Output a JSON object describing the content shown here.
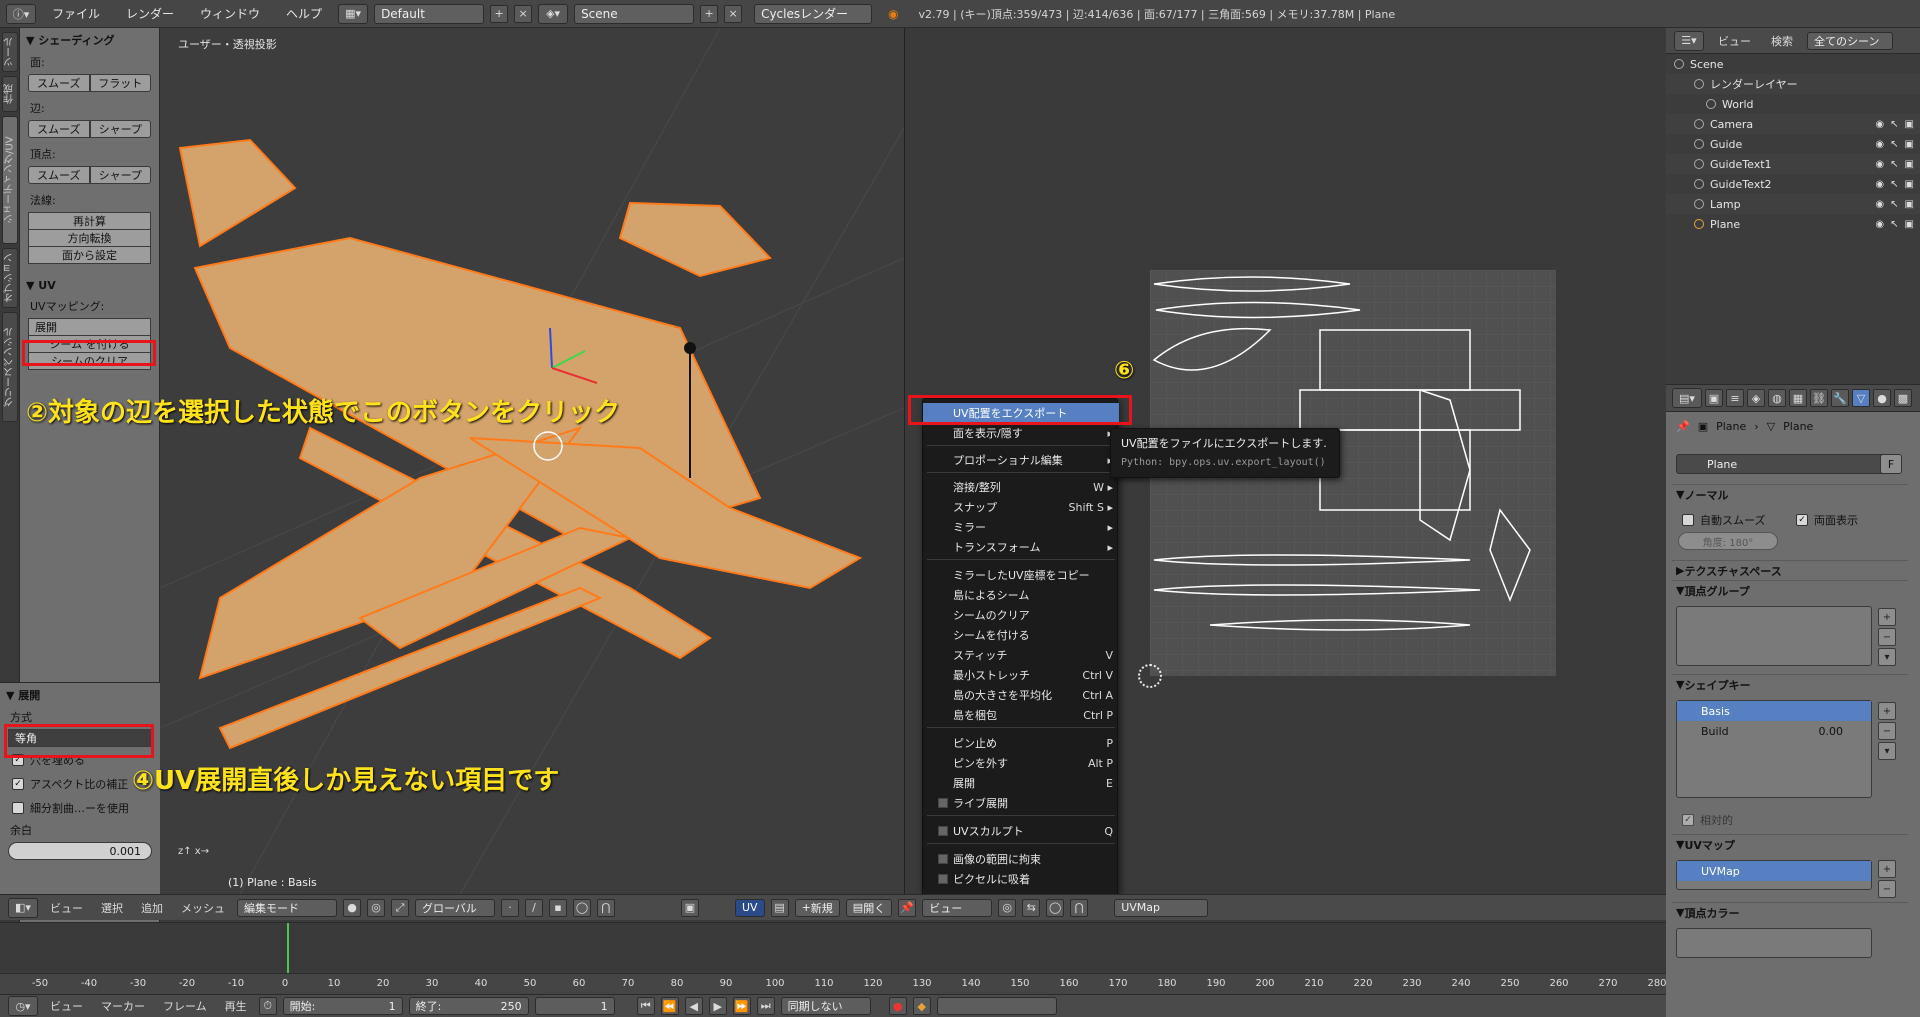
{
  "topbar": {
    "menus": [
      "ファイル",
      "レンダー",
      "ウィンドウ",
      "ヘルプ"
    ],
    "layout": "Default",
    "scene": "Scene",
    "engine": "Cyclesレンダー",
    "stats": "v2.79 | (キー)頂点:359/473 | 辺:414/636 | 面:67/177 | 三角面:569 | メモリ:37.78M | Plane"
  },
  "vtabs": [
    "ツール",
    "作成",
    "シェーディング/UV",
    "オプション",
    "グリースペンシル"
  ],
  "shading": {
    "title": "シェーディング",
    "face_label": "面:",
    "smooth": "スムーズ",
    "flat": "フラット",
    "edge_label": "辺:",
    "sharp": "シャープ",
    "vertex_label": "頂点:",
    "normals_label": "法線:",
    "recalc": "再計算",
    "flip": "方向転換",
    "from_face": "面から設定"
  },
  "uvpanel": {
    "title": "UV",
    "mapping_label": "UVマッピング:",
    "unwrap": "展開",
    "mark_seam": "シーム を付ける",
    "clear_seam": "シームのクリア"
  },
  "redo": {
    "title": "展開",
    "method_label": "方式",
    "method": "等角",
    "fill_holes": "穴を埋める",
    "aspect": "アスペクト比の補正",
    "subsurf": "細分割曲…ーを使用",
    "margin_label": "余白",
    "margin": "0.001"
  },
  "view3d": {
    "title": "ユーザー・透視投影",
    "footer": "(1) Plane : Basis"
  },
  "annotations": {
    "a2": "②対象の辺を選択した状態でこのボタンをクリック",
    "a4": "④UV展開直後しか見えない項目です",
    "a6": "⑥"
  },
  "uvmenu": {
    "items": [
      {
        "label": "UV配置をエクスポート",
        "shortcut": ""
      },
      {
        "label": "面を表示/隠す",
        "shortcut": ""
      },
      {
        "label": "プロポーショナル編集",
        "shortcut": ""
      },
      {
        "label": "溶接/整列",
        "shortcut": "W"
      },
      {
        "label": "スナップ",
        "shortcut": "Shift S"
      },
      {
        "label": "ミラー",
        "shortcut": ""
      },
      {
        "label": "トランスフォーム",
        "shortcut": ""
      },
      {
        "label": "ミラーしたUV座標をコピー",
        "shortcut": ""
      },
      {
        "label": "島によるシーム",
        "shortcut": ""
      },
      {
        "label": "シームのクリア",
        "shortcut": ""
      },
      {
        "label": "シームを付ける",
        "shortcut": ""
      },
      {
        "label": "スティッチ",
        "shortcut": "V"
      },
      {
        "label": "最小ストレッチ",
        "shortcut": "Ctrl V"
      },
      {
        "label": "島の大きさを平均化",
        "shortcut": "Ctrl A"
      },
      {
        "label": "島を梱包",
        "shortcut": "Ctrl P"
      },
      {
        "label": "ピン止め",
        "shortcut": "P"
      },
      {
        "label": "ピンを外す",
        "shortcut": "Alt P"
      },
      {
        "label": "展開",
        "shortcut": "E"
      },
      {
        "label": "ライブ展開",
        "shortcut": ""
      },
      {
        "label": "UVスカルプト",
        "shortcut": "Q"
      },
      {
        "label": "画像の範囲に拘束",
        "shortcut": ""
      },
      {
        "label": "ピクセルに吸着",
        "shortcut": ""
      }
    ]
  },
  "tooltip": {
    "desc": "UV配置をファイルにエクスポートします.",
    "python": "Python: bpy.ops.uv.export_layout()"
  },
  "outliner": {
    "menu_view": "ビュー",
    "menu_search": "検索",
    "filter": "全てのシーン",
    "rows": [
      "Scene",
      "レンダーレイヤー",
      "World",
      "Camera",
      "Guide",
      "GuideText1",
      "GuideText2",
      "Lamp",
      "Plane"
    ]
  },
  "props": {
    "crumb_obj": "Plane",
    "crumb_data": "Plane",
    "name": "Plane",
    "f_btn": "F",
    "normal_title": "ノーマル",
    "auto_smooth": "自動スムーズ",
    "double_sided": "両面表示",
    "angle": "角度:    180°",
    "texspace": "テクスチャスペース",
    "vgroups": "頂点グループ",
    "shapekeys": "シェイプキー",
    "sk1": "Basis",
    "sk2": "Build",
    "sk2_val": "0.00",
    "relative": "相対的",
    "uvmaps": "UVマップ",
    "uvmap1": "UVMap",
    "vcolors": "頂点カラー"
  },
  "header3d": {
    "view": "ビュー",
    "select": "選択",
    "add": "追加",
    "mesh": "メッシュ",
    "mode": "編集モード",
    "orient": "グローバル"
  },
  "headeruv": {
    "uv": "UV",
    "new": "新規",
    "open": "開く",
    "view": "ビュー",
    "uvmap": "UVMap"
  },
  "timeline": {
    "ticks": [
      "-50",
      "-40",
      "-30",
      "-20",
      "-10",
      "0",
      "10",
      "20",
      "30",
      "40",
      "50",
      "60",
      "70",
      "80",
      "90",
      "100",
      "110",
      "120",
      "130",
      "140",
      "150",
      "160",
      "170",
      "180",
      "190",
      "200",
      "210",
      "220",
      "230",
      "240",
      "250",
      "260",
      "270",
      "280"
    ],
    "view": "ビュー",
    "marker": "マーカー",
    "frame": "フレーム",
    "play": "再生",
    "start_label": "開始:",
    "start": "1",
    "end_label": "終了:",
    "end": "250",
    "current": "1",
    "sync": "同期しない"
  },
  "colors": {
    "accent": "#5680c2",
    "highlight_red": "#e8141b",
    "annotation": "#ffe21a",
    "mesh_fill": "#d4a36c",
    "mesh_edge": "#ff7a1a"
  }
}
